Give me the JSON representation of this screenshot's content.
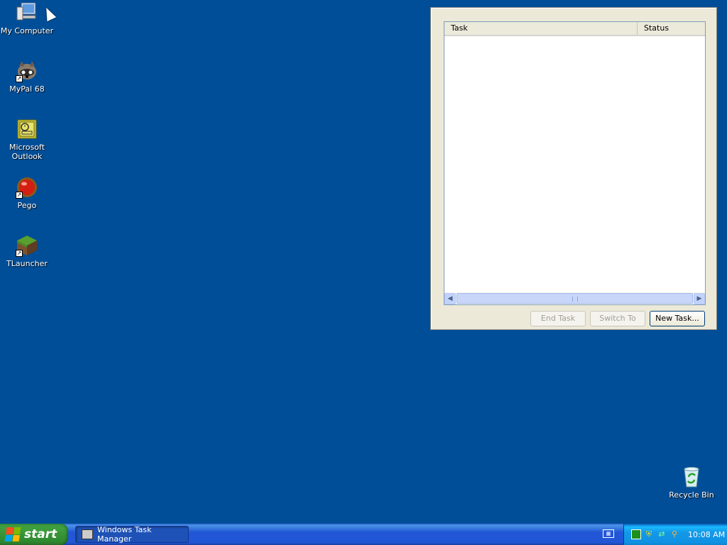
{
  "desktop": {
    "icons": [
      {
        "label": "My Computer",
        "icon": "my-computer-icon"
      },
      {
        "label": "MyPal 68",
        "icon": "raccoon-icon"
      },
      {
        "label": "Microsoft Outlook",
        "icon": "outlook-icon"
      },
      {
        "label": "Pego",
        "icon": "red-orb-icon"
      },
      {
        "label": "TLauncher",
        "icon": "grass-block-icon"
      },
      {
        "label": "Recycle Bin",
        "icon": "recycle-bin-icon"
      }
    ]
  },
  "task_manager": {
    "columns": {
      "task": "Task",
      "status": "Status"
    },
    "buttons": {
      "end_task": "End Task",
      "switch_to": "Switch To",
      "new_task": "New Task..."
    }
  },
  "taskbar": {
    "start_label": "start",
    "window_button": "Windows Task Manager",
    "clock": "10:08 AM"
  },
  "colors": {
    "desktop_bg": "#004e98",
    "taskbar_blue": "#2157d7",
    "start_green": "#3f9f3f"
  }
}
